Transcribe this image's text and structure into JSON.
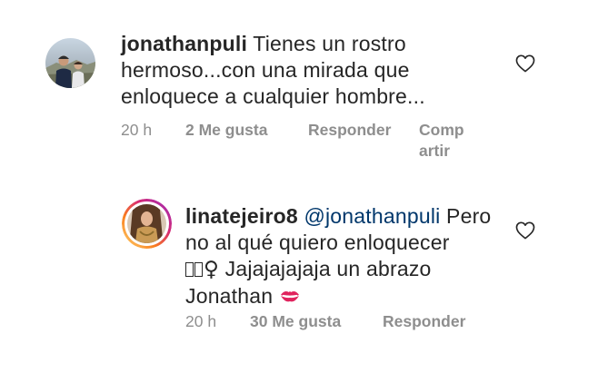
{
  "comments": [
    {
      "username": "jonathanpuli",
      "text_lines": [
        "Tienes un rostro",
        "hermoso...con una mirada que",
        "enloquece a cualquier hombre..."
      ],
      "time": "20 h",
      "likes": "2 Me gusta",
      "reply_label": "Responder",
      "share_label_1": "Comp",
      "share_label_2": "artir",
      "avatar_icon": "profile-photo"
    },
    {
      "username": "linatejeiro8",
      "mention": "@jonathanpuli",
      "text_line1_rest": "Pero",
      "text_line2": "no al qué quiero enloquecer",
      "text_line3_glyph": "♀",
      "text_line3_rest": " Jajajajajaja un abrazo",
      "text_line4": "Jonathan",
      "emoji_icon": "kiss-mark-icon",
      "time": "20 h",
      "likes": "30 Me gusta",
      "reply_label": "Responder",
      "avatar_icon": "story-ring-profile-photo",
      "story_ring_colors": [
        "#feda75",
        "#fa7e1e",
        "#d62976",
        "#962fbf"
      ]
    }
  ],
  "colors": {
    "text": "#262626",
    "secondary": "#8e8e8e",
    "mention": "#00376b",
    "kiss": "#e0245e"
  }
}
